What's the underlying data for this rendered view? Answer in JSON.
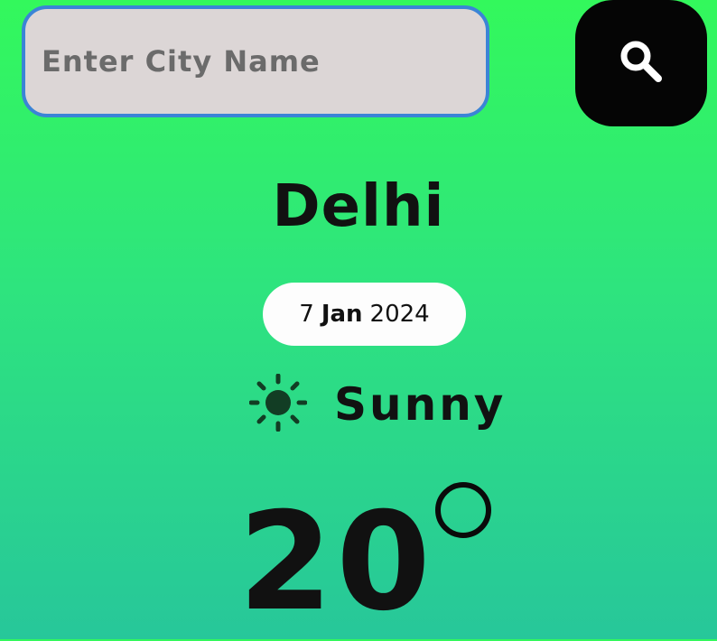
{
  "search": {
    "placeholder": "Enter City Name",
    "value": "",
    "button_icon": "search-icon"
  },
  "weather": {
    "city": "Delhi",
    "date": {
      "day": "7",
      "month": "Jan",
      "year": "2024"
    },
    "condition": "Sunny",
    "condition_icon": "sun-icon",
    "temperature": "20",
    "unit_icon": "degree-icon"
  },
  "colors": {
    "background_top": "#33f85c",
    "background_bottom": "#27c79a",
    "input_background": "#dcd6d6",
    "input_border": "#3b84d6",
    "button_background": "#050505",
    "pill_background": "#fdfdfd",
    "sun_color": "#123d24"
  }
}
